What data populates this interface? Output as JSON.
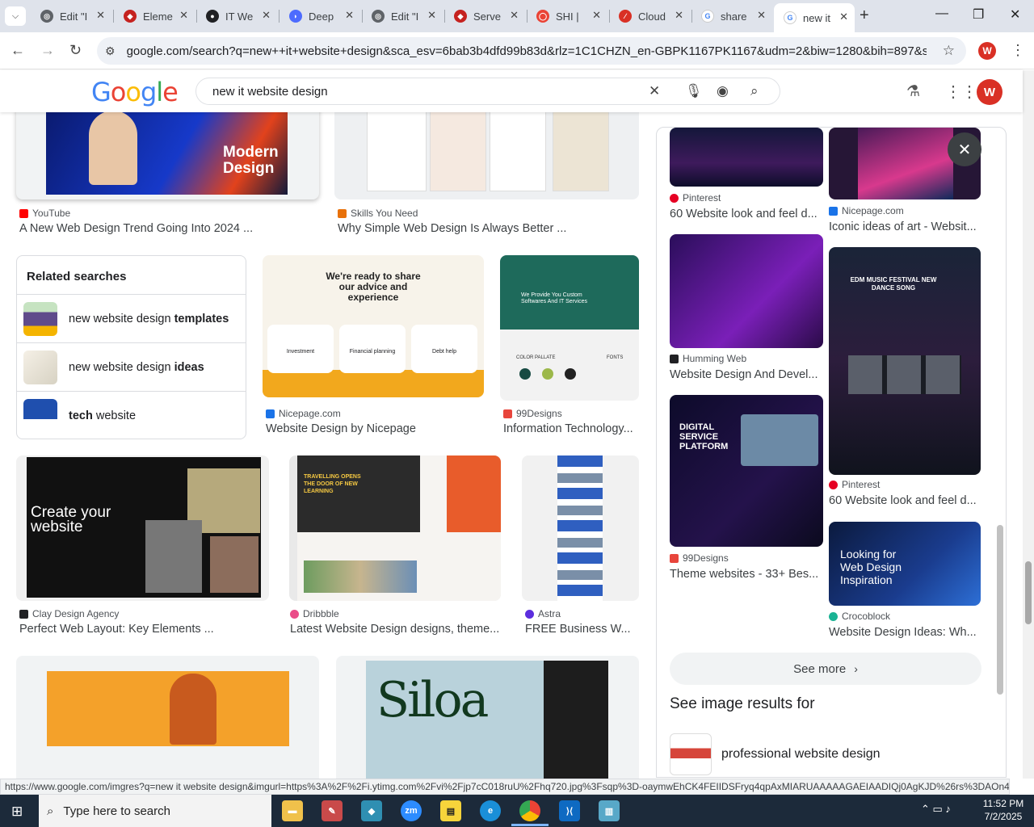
{
  "tabs": [
    {
      "title": "Edit \"I",
      "favicon_color": "#5f6368"
    },
    {
      "title": "Eleme",
      "favicon_color": "#c5221f"
    },
    {
      "title": "IT We",
      "favicon_color": "#202124"
    },
    {
      "title": "Deep",
      "favicon_color": "#4d6bfe"
    },
    {
      "title": "Edit \"I",
      "favicon_color": "#5f6368"
    },
    {
      "title": "Serve",
      "favicon_color": "#c5221f"
    },
    {
      "title": "SHI |",
      "favicon_color": "#ea4335"
    },
    {
      "title": "Cloud",
      "favicon_color": "#d93025"
    },
    {
      "title": "share",
      "favicon_color": "#4285f4"
    },
    {
      "title": "new it",
      "favicon_color": "#4285f4"
    }
  ],
  "address_bar": {
    "url": "google.com/search?q=new++it+website+design&sca_esv=6bab3b4dfd99b83d&rlz=1C1CHZN_en-GBPK1167PK1167&udm=2&biw=1280&bih=897&sxsrf=AE..."
  },
  "profile_initial": "W",
  "google": {
    "logo": "Google",
    "query": "new it website design"
  },
  "results": [
    {
      "source": "YouTube",
      "caption": "A New Web Design Trend Going Into 2024 ...",
      "color": "#ff0000"
    },
    {
      "source": "Skills You Need",
      "caption": "Why Simple Web Design Is Always Better ...",
      "color": "#e8710a"
    },
    {
      "source": "Nicepage.com",
      "caption": "Website Design by Nicepage",
      "color": "#1a73e8"
    },
    {
      "source": "99Designs",
      "caption": "Information Technology...",
      "color": "#e8453c"
    },
    {
      "source": "Clay Design Agency",
      "caption": "Perfect Web Layout: Key Elements ...",
      "color": "#202124"
    },
    {
      "source": "Dribbble",
      "caption": "Latest Website Design designs, theme...",
      "color": "#ea4c89"
    },
    {
      "source": "Astra",
      "caption": "FREE Business W...",
      "color": "#5c2ede"
    }
  ],
  "thumb_texts": {
    "modern_design": "Modern Design",
    "nicepage_head": "We're ready to share our advice and experience",
    "nicepage_cards": [
      "Investment",
      "Financial planning",
      "Debt help"
    ],
    "it_custom": "We Provide You Custom Softwares And IT Services",
    "color_pallete": "COLOR PALLATE",
    "fonts": "FONTS",
    "create_website": "Create your website",
    "travelling": "TRAVELLING OPENS THE DOOR OF NEW LEARNING",
    "siloa": "Siloa"
  },
  "related": {
    "heading": "Related searches",
    "items": [
      {
        "prefix": "new website design ",
        "bold": "templates"
      },
      {
        "prefix": "new website design ",
        "bold": "ideas"
      },
      {
        "prefix": "",
        "bold": "tech",
        "suffix": " website"
      }
    ]
  },
  "panel": {
    "results": [
      {
        "source": "Pinterest",
        "caption": "60 Website look and feel d...",
        "color": "#e60023"
      },
      {
        "source": "Nicepage.com",
        "caption": "Iconic ideas of art - Websit...",
        "color": "#1a73e8"
      },
      {
        "source": "Humming Web",
        "caption": "Website Design And Devel...",
        "color": "#202124"
      },
      {
        "source": "Pinterest",
        "caption": "60 Website look and feel d...",
        "color": "#e60023"
      },
      {
        "source": "99Designs",
        "caption": "Theme websites - 33+ Bes...",
        "color": "#e8453c"
      },
      {
        "source": "Crocoblock",
        "caption": "Website Design Ideas: Wh...",
        "color": "#1ab394"
      }
    ],
    "thumb_texts": {
      "edm": "EDM MUSIC FESTIVAL NEW DANCE SONG",
      "digital": "DIGITAL SERVICE PLATFORM",
      "croco": "Looking for Web Design Inspiration"
    },
    "see_more": "See more",
    "see_image_results": "See image results for",
    "suggestion": "professional website design"
  },
  "status_url": "https://www.google.com/imgres?q=new  it website design&imgurl=https%3A%2F%2Fi.ytimg.com%2Fvi%2Fjp7cC018ruU%2Fhq720.jpg%3Fsqp%3D-oaymwEhCK4FEIIDSFryq4qpAxMIARUAAAAAGAEIAADIQj0AgKJD%26rs%3DAOn4CL...",
  "taskbar": {
    "search_placeholder": "Type here to search",
    "time": "11:52 PM",
    "date": "7/2/2025"
  }
}
